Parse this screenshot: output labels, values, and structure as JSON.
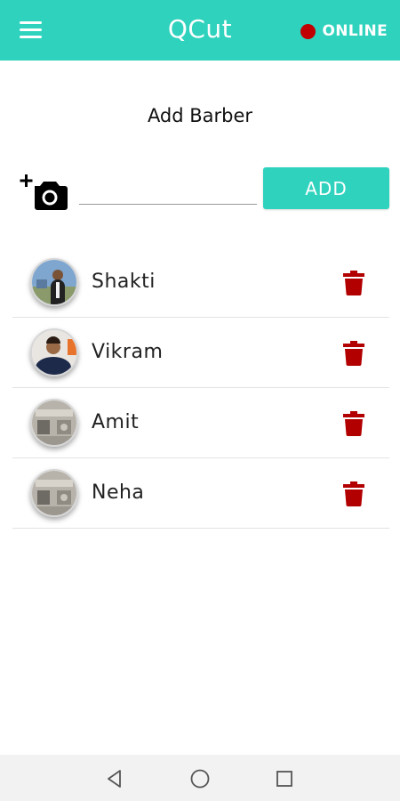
{
  "app": {
    "title": "QCut",
    "status": "ONLINE"
  },
  "colors": {
    "accent": "#2ED2BD",
    "status_dot": "#C00000",
    "delete": "#B20000"
  },
  "add_barber": {
    "title": "Add Barber",
    "name_value": "",
    "add_label": "ADD",
    "camera_icon": "add-photo-icon"
  },
  "barbers": [
    {
      "name": "Shakti"
    },
    {
      "name": "Vikram"
    },
    {
      "name": "Amit"
    },
    {
      "name": "Neha"
    }
  ],
  "navbar": {
    "icons": [
      "back-icon",
      "home-icon",
      "recents-icon"
    ]
  }
}
